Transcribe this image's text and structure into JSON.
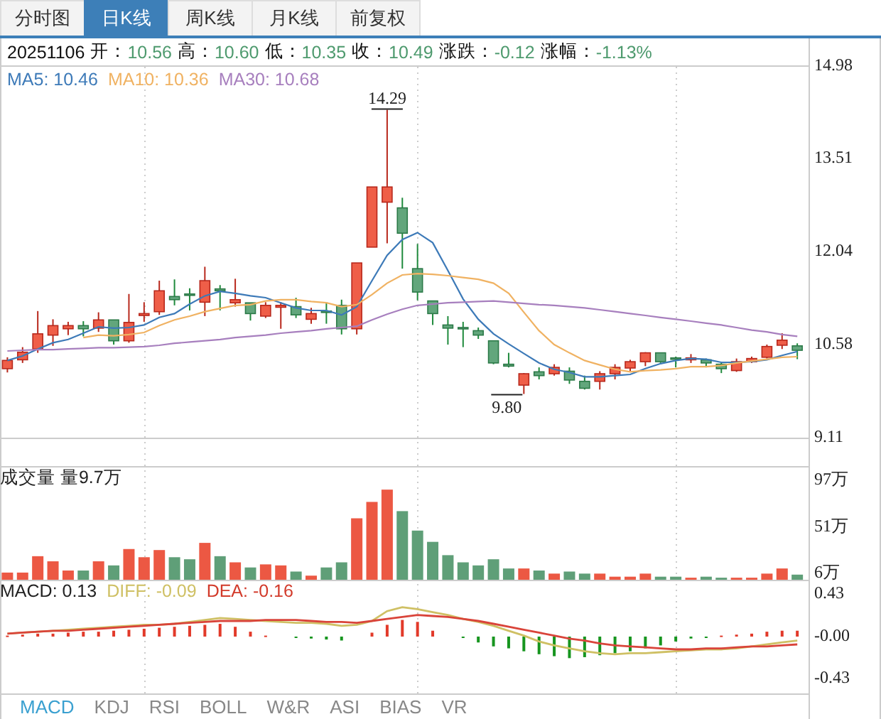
{
  "tabs": [
    {
      "label": "分时图",
      "selected": false
    },
    {
      "label": "日K线",
      "selected": true
    },
    {
      "label": "周K线",
      "selected": false
    },
    {
      "label": "月K线",
      "selected": false
    },
    {
      "label": "前复权",
      "selected": false
    }
  ],
  "quote": {
    "date": "20251106",
    "falling": true,
    "fields": [
      {
        "label": "开：",
        "value": "10.56"
      },
      {
        "label": "高：",
        "value": "10.60"
      },
      {
        "label": "低：",
        "value": "10.35"
      },
      {
        "label": "收：",
        "value": "10.49"
      },
      {
        "label": "涨跌：",
        "value": "-0.12"
      },
      {
        "label": "涨幅：",
        "value": "-1.13%"
      }
    ]
  },
  "price_chart": {
    "legend": [
      {
        "value": ": 10.46"
      },
      {
        "value": ": 10.36"
      },
      {
        "value": ": 10.68"
      }
    ],
    "high_label": "14.29",
    "low_label": "9.80",
    "chart_data": {
      "type": "candlestick",
      "ylim": [
        9.11,
        14.98
      ],
      "yticks": [
        9.11,
        10.58,
        12.04,
        13.51,
        14.98
      ],
      "categories": [
        null,
        null,
        null,
        null,
        null,
        null,
        null,
        null,
        null,
        null,
        null,
        null,
        null,
        null,
        null,
        null,
        null,
        null,
        null,
        null,
        null,
        null,
        null,
        null,
        null,
        null,
        null,
        null,
        null,
        null,
        null,
        null,
        null,
        null,
        null,
        null,
        null,
        null,
        null,
        null,
        null,
        null,
        null,
        null,
        null,
        null,
        null,
        null,
        null,
        null,
        null,
        null,
        null
      ],
      "ohlc": [
        [
          10.2,
          10.38,
          10.14,
          10.33
        ],
        [
          10.34,
          10.54,
          10.29,
          10.46
        ],
        [
          10.51,
          11.11,
          10.45,
          10.75
        ],
        [
          10.73,
          10.98,
          10.56,
          10.88
        ],
        [
          10.83,
          10.94,
          10.73,
          10.88
        ],
        [
          10.88,
          10.95,
          10.71,
          10.83
        ],
        [
          10.84,
          11.09,
          10.78,
          10.97
        ],
        [
          10.97,
          10.97,
          10.58,
          10.64
        ],
        [
          10.64,
          11.38,
          10.61,
          10.93
        ],
        [
          11.04,
          11.25,
          10.94,
          11.07
        ],
        [
          11.1,
          11.59,
          11.05,
          11.43
        ],
        [
          11.34,
          11.61,
          11.2,
          11.29
        ],
        [
          11.38,
          11.47,
          11.12,
          11.36
        ],
        [
          11.25,
          11.81,
          11.03,
          11.59
        ],
        [
          11.46,
          11.52,
          11.12,
          11.43
        ],
        [
          11.24,
          11.62,
          11.18,
          11.29
        ],
        [
          11.24,
          11.24,
          10.96,
          11.07
        ],
        [
          11.03,
          11.25,
          11.0,
          11.2
        ],
        [
          11.17,
          11.25,
          10.83,
          11.2
        ],
        [
          11.18,
          11.32,
          11.0,
          11.05
        ],
        [
          10.98,
          11.16,
          10.91,
          11.07
        ],
        [
          11.11,
          11.25,
          10.91,
          11.09
        ],
        [
          11.2,
          11.29,
          10.74,
          10.83
        ],
        [
          10.83,
          11.87,
          10.74,
          11.87
        ],
        [
          12.12,
          13.07,
          12.12,
          13.07
        ],
        [
          12.83,
          14.29,
          12.18,
          13.07
        ],
        [
          12.74,
          12.9,
          11.78,
          12.34
        ],
        [
          11.78,
          12.17,
          11.28,
          11.41
        ],
        [
          11.27,
          11.27,
          10.89,
          11.07
        ],
        [
          10.89,
          11.03,
          10.58,
          10.84
        ],
        [
          10.85,
          10.94,
          10.54,
          10.83
        ],
        [
          10.8,
          10.85,
          10.67,
          10.73
        ],
        [
          10.64,
          10.64,
          10.27,
          10.29
        ],
        [
          10.27,
          10.45,
          10.22,
          10.24
        ],
        [
          9.94,
          10.13,
          9.8,
          10.12
        ],
        [
          10.15,
          10.22,
          10.03,
          10.09
        ],
        [
          10.12,
          10.27,
          10.09,
          10.22
        ],
        [
          10.16,
          10.22,
          9.96,
          10.02
        ],
        [
          10.0,
          10.09,
          9.87,
          9.89
        ],
        [
          10.0,
          10.16,
          9.87,
          10.12
        ],
        [
          10.12,
          10.27,
          10.03,
          10.22
        ],
        [
          10.21,
          10.34,
          10.16,
          10.31
        ],
        [
          10.31,
          10.46,
          10.24,
          10.45
        ],
        [
          10.45,
          10.45,
          10.29,
          10.31
        ],
        [
          10.37,
          10.39,
          10.22,
          10.35
        ],
        [
          10.34,
          10.43,
          10.29,
          10.37
        ],
        [
          10.34,
          10.36,
          10.22,
          10.29
        ],
        [
          10.27,
          10.31,
          10.13,
          10.2
        ],
        [
          10.17,
          10.36,
          10.15,
          10.31
        ],
        [
          10.31,
          10.39,
          10.29,
          10.36
        ],
        [
          10.38,
          10.58,
          10.36,
          10.55
        ],
        [
          10.57,
          10.76,
          10.51,
          10.65
        ],
        [
          10.56,
          10.6,
          10.35,
          10.49
        ]
      ],
      "series": [
        {
          "name": "MA5",
          "type": "line",
          "color": "#3d7ab8",
          "values": [
            10.33,
            10.4,
            10.51,
            10.61,
            10.66,
            10.76,
            10.86,
            10.84,
            10.85,
            10.89,
            11.01,
            11.07,
            11.22,
            11.35,
            11.42,
            11.39,
            11.35,
            11.32,
            11.24,
            11.16,
            11.12,
            11.12,
            11.05,
            11.18,
            11.59,
            11.99,
            12.24,
            12.35,
            12.19,
            11.75,
            11.3,
            10.98,
            10.75,
            10.59,
            10.44,
            10.29,
            10.19,
            10.14,
            10.07,
            10.07,
            10.09,
            10.11,
            10.2,
            10.28,
            10.33,
            10.36,
            10.35,
            10.3,
            10.3,
            10.31,
            10.34,
            10.41,
            10.47
          ]
        },
        {
          "name": "MA10",
          "type": "line",
          "color": "#f0b262",
          "values": [
            null,
            null,
            null,
            null,
            null,
            10.69,
            10.73,
            10.72,
            10.74,
            10.77,
            10.88,
            10.97,
            11.03,
            11.1,
            11.15,
            11.2,
            11.21,
            11.27,
            11.29,
            11.29,
            11.26,
            11.24,
            11.18,
            11.21,
            11.37,
            11.55,
            11.68,
            11.7,
            11.69,
            11.67,
            11.64,
            11.61,
            11.55,
            11.39,
            11.09,
            10.8,
            10.58,
            10.45,
            10.33,
            10.26,
            10.19,
            10.15,
            10.17,
            10.18,
            10.2,
            10.23,
            10.23,
            10.25,
            10.29,
            10.32,
            10.35,
            10.38,
            10.39
          ]
        },
        {
          "name": "MA30",
          "type": "line",
          "color": "#a77fbe",
          "values": [
            10.48,
            10.49,
            10.5,
            10.5,
            10.51,
            10.52,
            10.53,
            10.53,
            10.54,
            10.55,
            10.57,
            10.6,
            10.62,
            10.64,
            10.66,
            10.69,
            10.71,
            10.73,
            10.76,
            10.78,
            10.8,
            10.83,
            10.85,
            10.87,
            10.97,
            11.06,
            11.14,
            11.2,
            11.22,
            11.24,
            11.25,
            11.26,
            11.27,
            11.25,
            11.23,
            11.21,
            11.2,
            11.18,
            11.16,
            11.13,
            11.1,
            11.07,
            11.04,
            11.01,
            10.98,
            10.95,
            10.92,
            10.89,
            10.85,
            10.81,
            10.78,
            10.74,
            10.71
          ]
        }
      ]
    }
  },
  "volume_chart": {
    "title": "成交量 量9.7万",
    "chart_data": {
      "type": "bar",
      "ylim": [
        0,
        111
      ],
      "yticks": [
        {
          "value": 6,
          "label": "6万"
        },
        {
          "value": 51,
          "label": "51万"
        },
        {
          "value": 97,
          "label": "97万"
        }
      ],
      "categories": [
        null,
        null,
        null,
        null,
        null,
        null,
        null,
        null,
        null,
        null,
        null,
        null,
        null,
        null,
        null,
        null,
        null,
        null,
        null,
        null,
        null,
        null,
        null,
        null,
        null,
        null,
        null,
        null,
        null,
        null,
        null,
        null,
        null,
        null,
        null,
        null,
        null,
        null,
        null,
        null,
        null,
        null,
        null,
        null,
        null,
        null,
        null,
        null,
        null,
        null,
        null,
        null,
        null
      ],
      "values": [
        7,
        7,
        23,
        18,
        9,
        9,
        18,
        14,
        30,
        22,
        29,
        22,
        20,
        36,
        23,
        17,
        12,
        15,
        14,
        8,
        4,
        12,
        17,
        60,
        76,
        88,
        67,
        48,
        37,
        24,
        17,
        14,
        20,
        11,
        11,
        9,
        6,
        8,
        6,
        6,
        3,
        3,
        6,
        3,
        3,
        2,
        3,
        2,
        2,
        2,
        6,
        11,
        5
      ]
    }
  },
  "macd": {
    "legend": [
      {
        "value": ": 0.13",
        "color": "#222222"
      },
      {
        "value": ": -0.09",
        "color": "#cfc064"
      },
      {
        "value": ": -0.16",
        "color": "#d23a2a"
      }
    ],
    "chart_data": {
      "type": "bar",
      "ylim": [
        -0.58,
        0.58
      ],
      "yticks": [
        {
          "value": -0.43,
          "label": "-0.43"
        },
        {
          "value": 0,
          "label": "-0.00"
        },
        {
          "value": 0.43,
          "label": "0.43"
        }
      ],
      "categories": [
        null,
        null,
        null,
        null,
        null,
        null,
        null,
        null,
        null,
        null,
        null,
        null,
        null,
        null,
        null,
        null,
        null,
        null,
        null,
        null,
        null,
        null,
        null,
        null,
        null,
        null,
        null,
        null,
        null,
        null,
        null,
        null,
        null,
        null,
        null,
        null,
        null,
        null,
        null,
        null,
        null,
        null,
        null,
        null,
        null,
        null,
        null,
        null,
        null,
        null,
        null,
        null,
        null
      ],
      "series": [
        {
          "name": "MACD",
          "type": "bar",
          "colors": [
            "#e23a2a",
            "#e23a2a",
            "#e23a2a",
            "#e23a2a",
            "#e23a2a",
            "#e23a2a",
            "#e23a2a",
            "#e23a2a",
            "#e23a2a",
            "#e23a2a",
            "#e23a2a",
            "#e23a2a",
            "#e23a2a",
            "#e23a2a",
            "#e23a2a",
            "#e23a2a",
            "#e23a2a",
            "#e23a2a",
            null,
            "#17951f",
            "#17951f",
            "#17951f",
            "#17951f",
            null,
            "#e23a2a",
            "#e23a2a",
            "#e23a2a",
            "#e23a2a",
            "#e23a2a",
            null,
            "#17951f",
            "#17951f",
            "#17951f",
            "#17951f",
            "#17951f",
            "#17951f",
            "#17951f",
            "#17951f",
            "#17951f",
            "#17951f",
            "#17951f",
            "#17951f",
            "#17951f",
            "#17951f",
            "#17951f",
            "#17951f",
            "#17951f",
            "#e23a2a",
            "#e23a2a",
            "#e23a2a",
            "#e23a2a",
            "#e23a2a",
            "#e23a2a"
          ],
          "values": [
            0.01,
            0.02,
            0.03,
            0.03,
            0.04,
            0.05,
            0.05,
            0.06,
            0.07,
            0.08,
            0.09,
            0.1,
            0.11,
            0.12,
            0.13,
            0.1,
            0.05,
            0.01,
            0,
            -0.01,
            -0.02,
            -0.03,
            -0.04,
            0,
            0.04,
            0.12,
            0.17,
            0.15,
            0.06,
            0,
            -0.01,
            -0.06,
            -0.1,
            -0.12,
            -0.15,
            -0.18,
            -0.2,
            -0.22,
            -0.21,
            -0.19,
            -0.17,
            -0.15,
            -0.12,
            -0.09,
            -0.05,
            -0.02,
            -0.01,
            0.01,
            0.02,
            0.03,
            0.05,
            0.06,
            0.06
          ]
        },
        {
          "name": "DIFF",
          "type": "line",
          "color": "#cfc064",
          "values": [
            0.03,
            0.04,
            0.05,
            0.06,
            0.07,
            0.08,
            0.09,
            0.1,
            0.11,
            0.12,
            0.12,
            0.13,
            0.15,
            0.17,
            0.19,
            0.18,
            0.17,
            0.16,
            0.15,
            0.14,
            0.14,
            0.13,
            0.11,
            0.12,
            0.16,
            0.26,
            0.3,
            0.28,
            0.25,
            0.22,
            0.18,
            0.15,
            0.11,
            0.06,
            0.01,
            -0.05,
            -0.09,
            -0.12,
            -0.15,
            -0.17,
            -0.18,
            -0.17,
            -0.17,
            -0.16,
            -0.15,
            -0.14,
            -0.13,
            -0.13,
            -0.12,
            -0.1,
            -0.08,
            -0.06,
            -0.04
          ]
        },
        {
          "name": "DEA",
          "type": "line",
          "color": "#d9443a",
          "values": [
            0.03,
            0.04,
            0.05,
            0.06,
            0.06,
            0.07,
            0.08,
            0.09,
            0.1,
            0.11,
            0.12,
            0.13,
            0.14,
            0.15,
            0.16,
            0.16,
            0.16,
            0.17,
            0.17,
            0.17,
            0.16,
            0.15,
            0.15,
            0.14,
            0.16,
            0.18,
            0.2,
            0.22,
            0.21,
            0.2,
            0.18,
            0.16,
            0.13,
            0.1,
            0.07,
            0.04,
            0.01,
            -0.02,
            -0.04,
            -0.07,
            -0.09,
            -0.1,
            -0.11,
            -0.12,
            -0.13,
            -0.13,
            -0.12,
            -0.12,
            -0.11,
            -0.1,
            -0.1,
            -0.09,
            -0.08
          ]
        }
      ]
    }
  },
  "indicator_tabs": [
    {
      "label": "MACD",
      "selected": true
    },
    {
      "label": "KDJ",
      "selected": false
    },
    {
      "label": "RSI",
      "selected": false
    },
    {
      "label": "BOLL",
      "selected": false
    },
    {
      "label": "W&R",
      "selected": false
    },
    {
      "label": "ASI",
      "selected": false
    },
    {
      "label": "BIAS",
      "selected": false
    },
    {
      "label": "VR",
      "selected": false
    }
  ]
}
